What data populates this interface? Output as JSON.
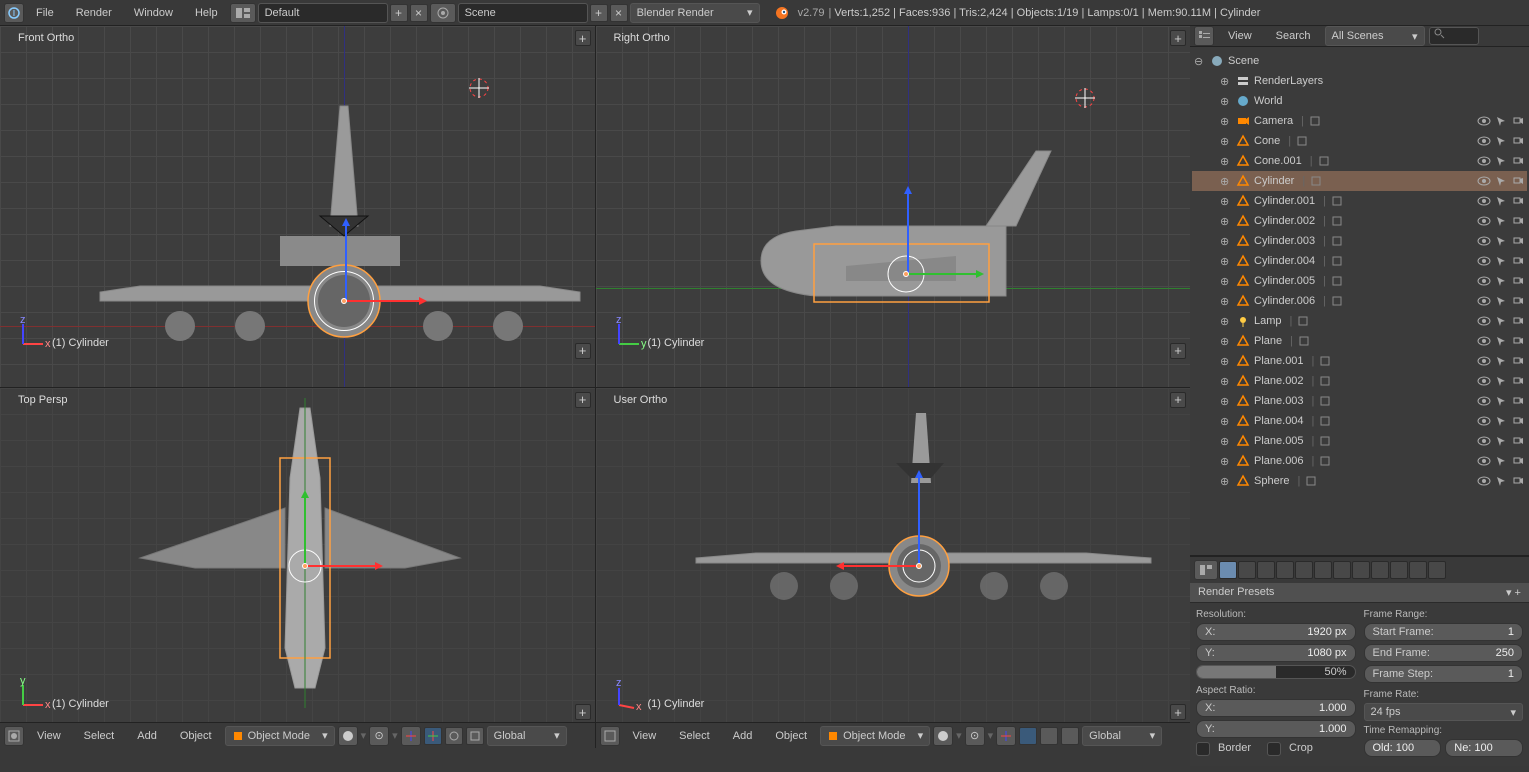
{
  "topbar": {
    "menus": [
      "File",
      "Render",
      "Window",
      "Help"
    ],
    "layout": "Default",
    "scene": "Scene",
    "engine": "Blender Render",
    "version": "v2.79",
    "stats": "Verts:1,252 | Faces:936 | Tris:2,424 | Objects:1/19 | Lamps:0/1 | Mem:90.11M | Cylinder"
  },
  "viewports": [
    {
      "label": "Front Ortho",
      "object": "(1) Cylinder",
      "axes": [
        "x",
        "z"
      ]
    },
    {
      "label": "Right Ortho",
      "object": "(1) Cylinder",
      "axes": [
        "y",
        "z"
      ]
    },
    {
      "label": "Top Persp",
      "object": "(1) Cylinder",
      "axes": [
        "x",
        "y"
      ]
    },
    {
      "label": "User Ortho",
      "object": "(1) Cylinder",
      "axes": [
        "x",
        "z"
      ]
    }
  ],
  "vtoolbar": {
    "menus": [
      "View",
      "Select",
      "Add",
      "Object"
    ],
    "mode": "Object Mode",
    "orient": "Global"
  },
  "outliner": {
    "menus": [
      "View",
      "Search"
    ],
    "filter": "All Scenes",
    "root": "Scene",
    "items": [
      {
        "name": "RenderLayers",
        "icon": "layers",
        "indent": 1
      },
      {
        "name": "World",
        "icon": "world",
        "indent": 1
      },
      {
        "name": "Camera",
        "icon": "camera",
        "indent": 1,
        "vis": true
      },
      {
        "name": "Cone",
        "icon": "mesh",
        "indent": 1,
        "vis": true
      },
      {
        "name": "Cone.001",
        "icon": "mesh",
        "indent": 1,
        "vis": true
      },
      {
        "name": "Cylinder",
        "icon": "mesh",
        "indent": 1,
        "vis": true,
        "selected": true
      },
      {
        "name": "Cylinder.001",
        "icon": "mesh",
        "indent": 1,
        "vis": true
      },
      {
        "name": "Cylinder.002",
        "icon": "mesh",
        "indent": 1,
        "vis": true
      },
      {
        "name": "Cylinder.003",
        "icon": "mesh",
        "indent": 1,
        "vis": true
      },
      {
        "name": "Cylinder.004",
        "icon": "mesh",
        "indent": 1,
        "vis": true
      },
      {
        "name": "Cylinder.005",
        "icon": "mesh",
        "indent": 1,
        "vis": true
      },
      {
        "name": "Cylinder.006",
        "icon": "mesh",
        "indent": 1,
        "vis": true
      },
      {
        "name": "Lamp",
        "icon": "lamp",
        "indent": 1,
        "vis": true
      },
      {
        "name": "Plane",
        "icon": "mesh",
        "indent": 1,
        "vis": true
      },
      {
        "name": "Plane.001",
        "icon": "mesh",
        "indent": 1,
        "vis": true
      },
      {
        "name": "Plane.002",
        "icon": "mesh",
        "indent": 1,
        "vis": true
      },
      {
        "name": "Plane.003",
        "icon": "mesh",
        "indent": 1,
        "vis": true
      },
      {
        "name": "Plane.004",
        "icon": "mesh",
        "indent": 1,
        "vis": true
      },
      {
        "name": "Plane.005",
        "icon": "mesh",
        "indent": 1,
        "vis": true
      },
      {
        "name": "Plane.006",
        "icon": "mesh",
        "indent": 1,
        "vis": true
      },
      {
        "name": "Sphere",
        "icon": "mesh",
        "indent": 1,
        "vis": true
      }
    ]
  },
  "props": {
    "preset_label": "Render Presets",
    "resolution": {
      "label": "Resolution:",
      "x": "1920 px",
      "y": "1080 px",
      "pct": "50%",
      "x_lbl": "X:",
      "y_lbl": "Y:"
    },
    "frame_range": {
      "label": "Frame Range:",
      "start_lbl": "Start Frame:",
      "start": "1",
      "end_lbl": "End Frame:",
      "end": "250",
      "step_lbl": "Frame Step:",
      "step": "1"
    },
    "aspect": {
      "label": "Aspect Ratio:",
      "x_lbl": "X:",
      "x": "1.000",
      "y_lbl": "Y:",
      "y": "1.000"
    },
    "frame_rate": {
      "label": "Frame Rate:",
      "value": "24 fps",
      "remap_lbl": "Time Remapping:",
      "old": "Old: 100",
      "new": "Ne:  100"
    },
    "border": "Border",
    "crop": "Crop"
  }
}
